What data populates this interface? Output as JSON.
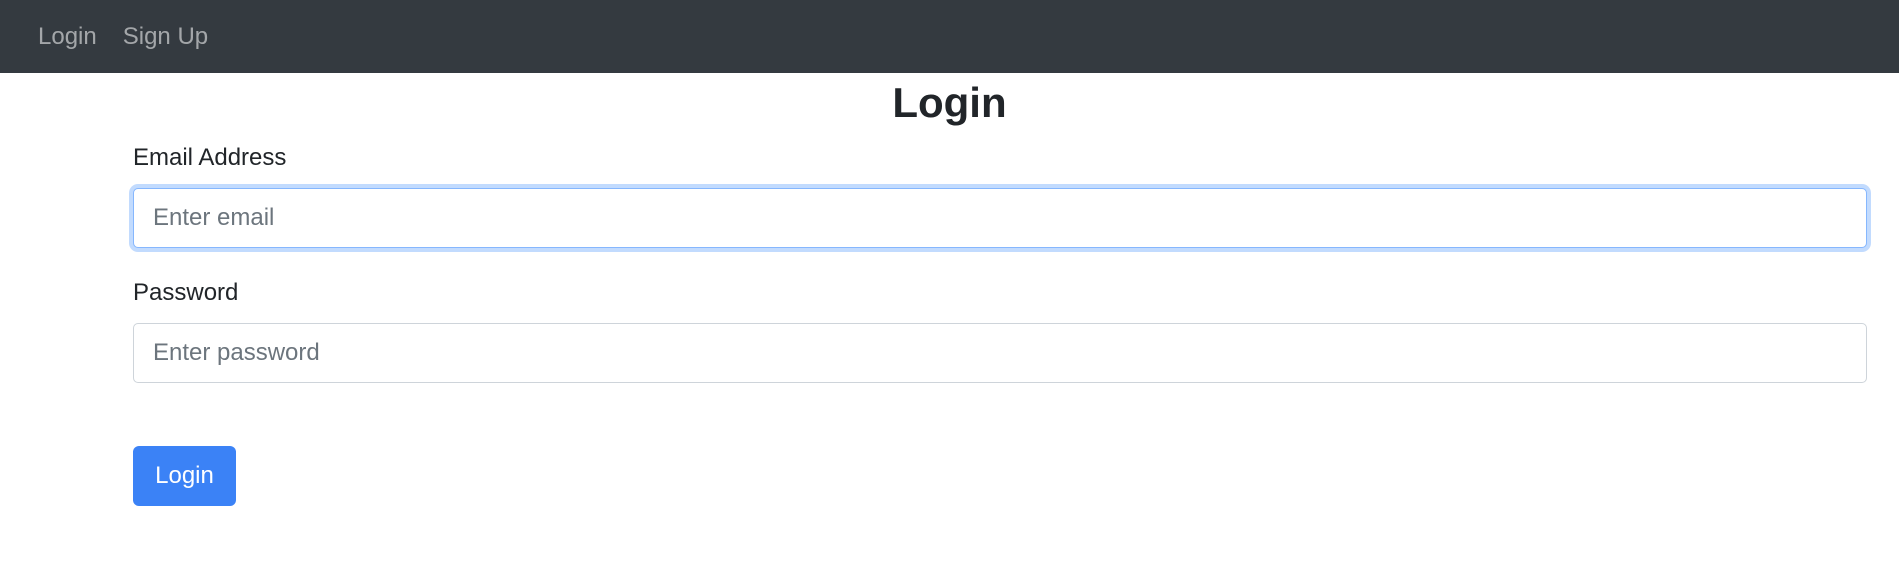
{
  "navbar": {
    "links": [
      {
        "label": "Login"
      },
      {
        "label": "Sign Up"
      }
    ]
  },
  "main": {
    "title": "Login",
    "email": {
      "label": "Email Address",
      "placeholder": "Enter email",
      "value": ""
    },
    "password": {
      "label": "Password",
      "placeholder": "Enter password",
      "value": ""
    },
    "submit_label": "Login"
  },
  "colors": {
    "navbar_bg": "#343a40",
    "primary": "#3b82f6",
    "focus_ring": "#86b7fe"
  }
}
